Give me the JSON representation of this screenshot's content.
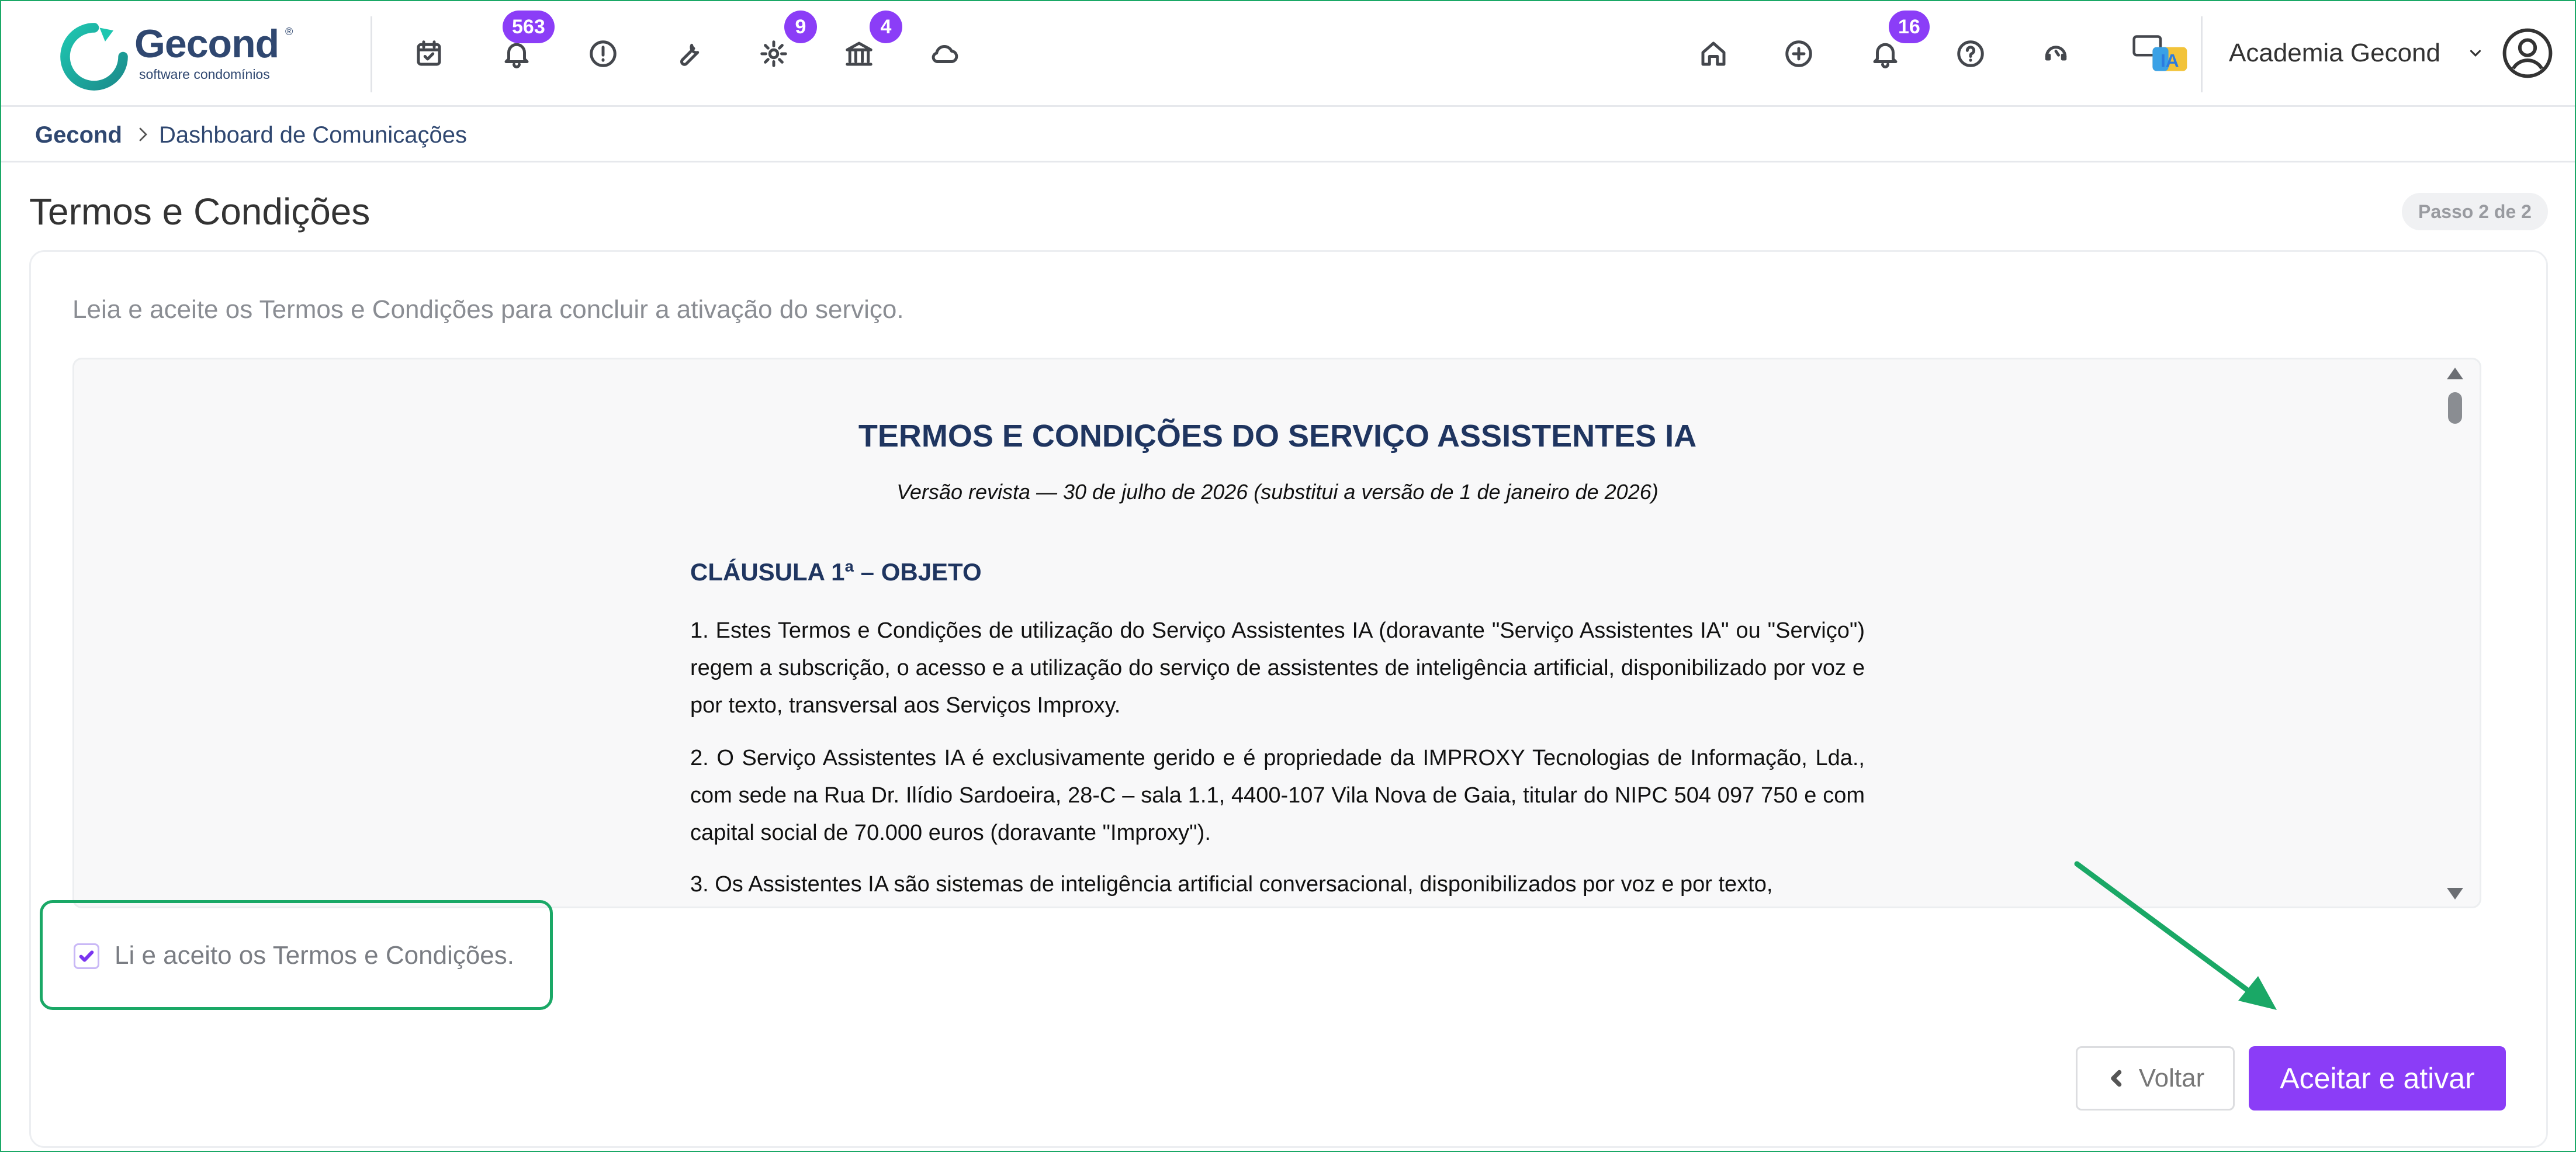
{
  "app": {
    "brand": "Gecond",
    "brand_reg": "®",
    "brand_sub": "software condomínios"
  },
  "toolbar_left": [
    {
      "icon": "calendar-check-icon"
    },
    {
      "icon": "bell-icon",
      "badge": "563"
    },
    {
      "icon": "alert-circle-icon"
    },
    {
      "icon": "wrench-icon"
    },
    {
      "icon": "gear-icon",
      "badge": "9"
    },
    {
      "icon": "bank-icon",
      "badge": "4"
    },
    {
      "icon": "cloud-icon"
    }
  ],
  "toolbar_right": [
    {
      "icon": "home-icon"
    },
    {
      "icon": "plus-circle-icon"
    },
    {
      "icon": "bell-icon",
      "badge": "16"
    },
    {
      "icon": "help-circle-icon"
    },
    {
      "icon": "support-headset-icon"
    },
    {
      "icon": "ia-assistant-icon",
      "label": "IA"
    }
  ],
  "account": {
    "name": "Academia Gecond",
    "avatar_icon": "user-circle-icon"
  },
  "breadcrumb": {
    "root": "Gecond",
    "current": "Dashboard de Comunicações"
  },
  "page": {
    "title": "Termos e Condições",
    "step": "Passo 2 de 2",
    "intro": "Leia e aceite os Termos e Condições para concluir a ativação do serviço."
  },
  "document": {
    "title": "TERMOS E CONDIÇÕES DO SERVIÇO ASSISTENTES IA",
    "version": "Versão revista — 30 de julho de 2026 (substitui a versão de 1 de janeiro de 2026)",
    "clause": "CLÁUSULA 1ª – OBJETO",
    "paragraphs": [
      "1. Estes Termos e Condições de utilização do Serviço Assistentes IA (doravante \"Serviço Assistentes IA\" ou \"Serviço\") regem a subscrição, o acesso e a utilização do serviço de assistentes de inteligência artificial, disponibilizado por voz e por texto, transversal aos Serviços Improxy.",
      "2. O Serviço Assistentes IA é exclusivamente gerido e é propriedade da IMPROXY Tecnologias de Informação, Lda., com sede na Rua Dr. Ilídio Sardoeira, 28-C – sala 1.1, 4400-107 Vila Nova de Gaia, titular do NIPC 504 097 750 e com capital social de 70.000 euros (doravante \"Improxy\").",
      "3. Os Assistentes IA são sistemas de inteligência artificial conversacional, disponibilizados por voz e por texto,"
    ]
  },
  "accept": {
    "label": "Li e aceito os Termos e Condições.",
    "checked": true
  },
  "buttons": {
    "back": "Voltar",
    "accept": "Aceitar e ativar"
  },
  "colors": {
    "accent": "#8b3df7",
    "highlight": "#1aa866",
    "brand": "#2f4770"
  }
}
